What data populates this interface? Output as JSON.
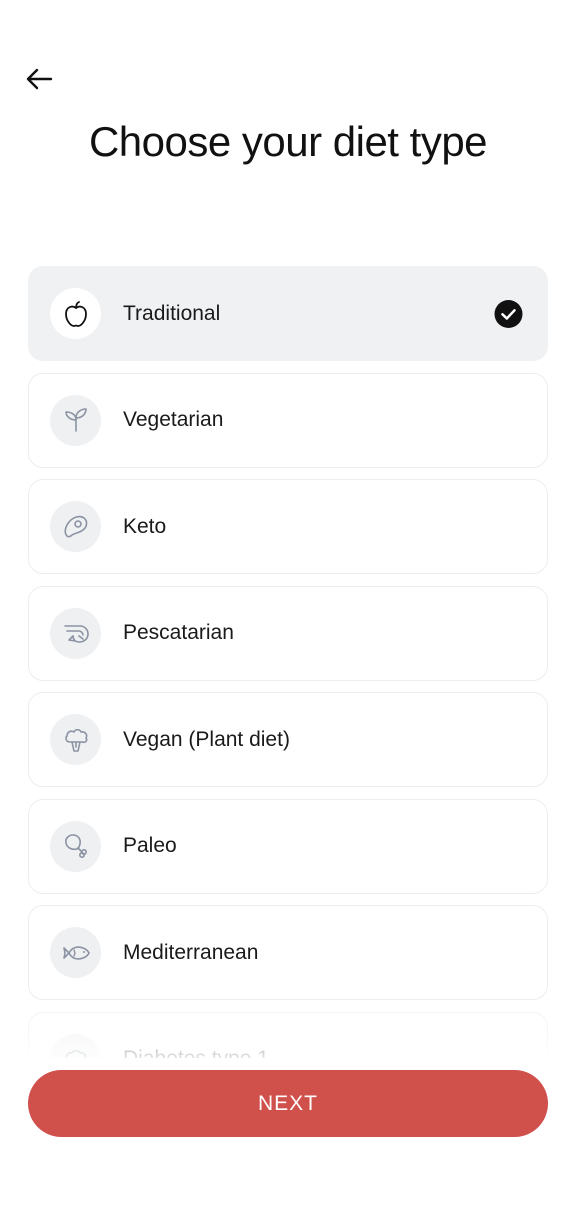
{
  "header": {
    "back_icon": "arrow-left-icon",
    "title": "Choose your diet type"
  },
  "options": [
    {
      "label": "Traditional",
      "icon": "apple-icon",
      "selected": true
    },
    {
      "label": "Vegetarian",
      "icon": "sprout-icon",
      "selected": false
    },
    {
      "label": "Keto",
      "icon": "steak-icon",
      "selected": false
    },
    {
      "label": "Pescatarian",
      "icon": "shrimp-icon",
      "selected": false
    },
    {
      "label": "Vegan (Plant diet)",
      "icon": "broccoli-icon",
      "selected": false
    },
    {
      "label": "Paleo",
      "icon": "drumstick-icon",
      "selected": false
    },
    {
      "label": "Mediterranean",
      "icon": "fish-icon",
      "selected": false
    },
    {
      "label": "Diabetes type 1",
      "icon": "cupcake-icon",
      "selected": false
    }
  ],
  "footer": {
    "next_label": "NEXT"
  },
  "colors": {
    "primary": "#d0504c",
    "selected_bg": "#f0f1f3",
    "border": "#ebedf0",
    "icon_stroke": "#8b93a3"
  }
}
